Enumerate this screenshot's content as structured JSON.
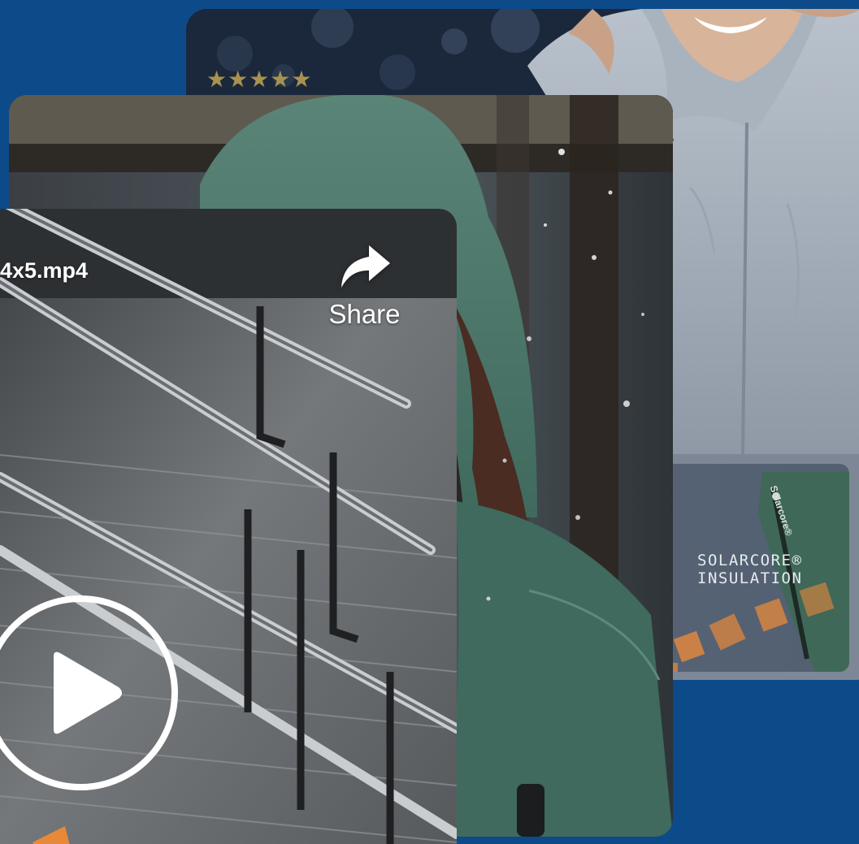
{
  "review": {
    "stars": "★★★★★",
    "rating_count": 5
  },
  "feature": {
    "label": "SOLARCORE®\nINSULATION",
    "pocket_tag": "Solarcore®"
  },
  "video": {
    "filename": "4x5.mp4",
    "share_label": "Share"
  },
  "icons": {
    "share": "share-arrow-icon",
    "play": "play-icon",
    "stars": "star-icon"
  },
  "colors": {
    "background": "#0d4a8a",
    "star": "#a8924f",
    "jacket_green": "#4d7a6d",
    "accent_orange": "#e8893a",
    "text_on_media": "#ffffff"
  }
}
